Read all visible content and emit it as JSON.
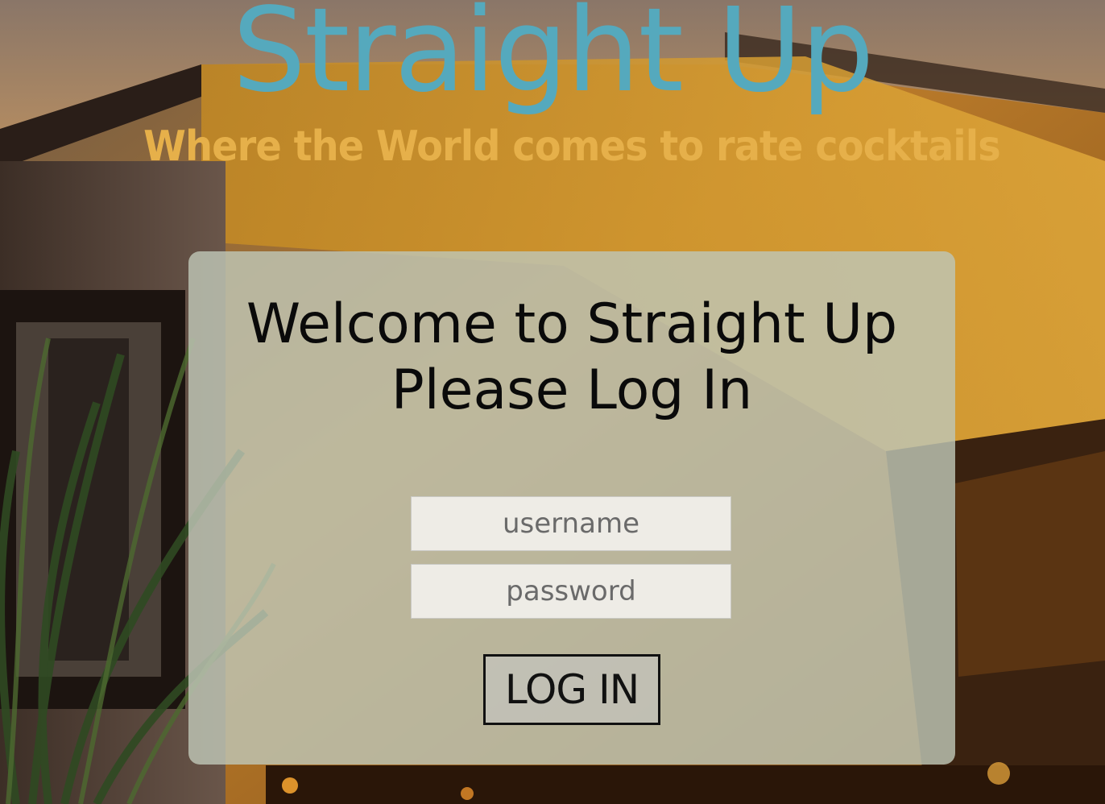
{
  "header": {
    "title": "Straight Up",
    "tagline": "Where the World comes to rate cocktails"
  },
  "login": {
    "welcome_line1": "Welcome to Straight Up",
    "welcome_line2": "Please Log In",
    "username_placeholder": "username",
    "password_placeholder": "password",
    "button_label": "LOG IN"
  },
  "colors": {
    "title": "#55a9bd",
    "tagline": "#e6b04a",
    "panel": "#bec6b6"
  }
}
